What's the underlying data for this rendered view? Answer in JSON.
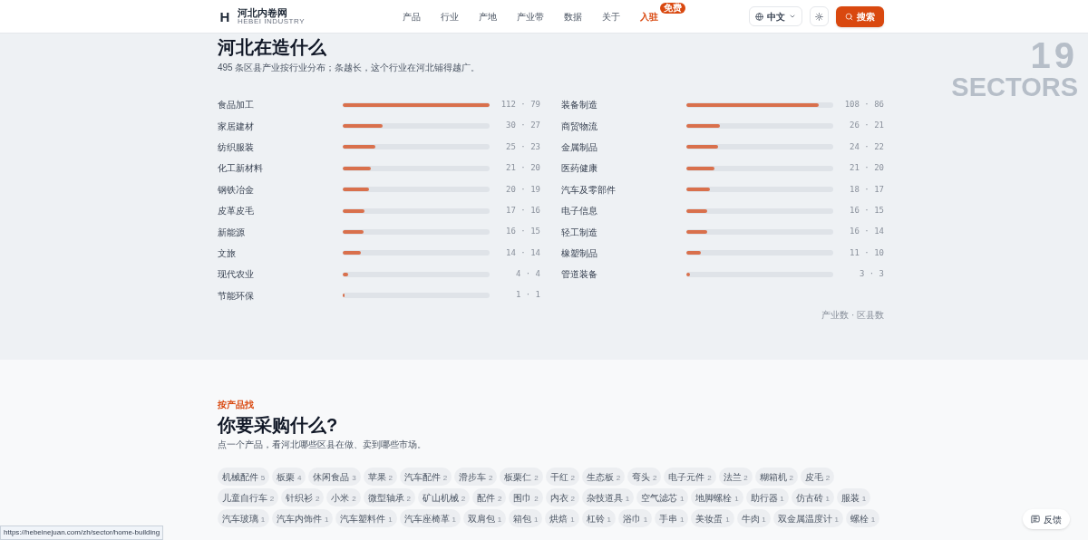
{
  "header": {
    "logo_letter": "H",
    "site_name": "河北内卷网",
    "site_subtitle": "HEBEI INDUSTRY",
    "nav": [
      {
        "label": "产品",
        "selected": false
      },
      {
        "label": "行业",
        "selected": false
      },
      {
        "label": "产地",
        "selected": false
      },
      {
        "label": "产业带",
        "selected": false
      },
      {
        "label": "数据",
        "selected": false
      },
      {
        "label": "关于",
        "selected": false
      },
      {
        "label": "入驻",
        "selected": true,
        "badge": "免费"
      }
    ],
    "language": "中文",
    "search_button": "搜索"
  },
  "sectors_section": {
    "title": "河北在造什么",
    "subtitle": "495 条区县产业按行业分布；条越长，这个行业在河北铺得越广。",
    "watermark_number": "19",
    "watermark_label": "SECTORS",
    "columns": [
      {
        "items": [
          {
            "name": "食品加工",
            "level": 1,
            "reading": "112 · 79"
          },
          {
            "name": "家居建材",
            "level": 0.27,
            "reading": "30 · 27"
          },
          {
            "name": "纺织服装",
            "level": 0.22,
            "reading": "25 · 23"
          },
          {
            "name": "化工新材料",
            "level": 0.19,
            "reading": "21 · 20"
          },
          {
            "name": "钢铁冶金",
            "level": 0.18,
            "reading": "20 · 19"
          },
          {
            "name": "皮革皮毛",
            "level": 0.15,
            "reading": "17 · 16"
          },
          {
            "name": "新能源",
            "level": 0.14,
            "reading": "16 · 15"
          },
          {
            "name": "文旅",
            "level": 0.125,
            "reading": "14 · 14"
          },
          {
            "name": "现代农业",
            "level": 0.036,
            "reading": "4 · 4"
          },
          {
            "name": "节能环保",
            "level": 0.01,
            "reading": "1 · 1"
          }
        ]
      },
      {
        "items": [
          {
            "name": "装备制造",
            "level": 0.9,
            "reading": "108 · 86"
          },
          {
            "name": "商贸物流",
            "level": 0.23,
            "reading": "26 · 21"
          },
          {
            "name": "金属制品",
            "level": 0.214,
            "reading": "24 · 22"
          },
          {
            "name": "医药健康",
            "level": 0.19,
            "reading": "21 · 20"
          },
          {
            "name": "汽车及零部件",
            "level": 0.16,
            "reading": "18 · 17"
          },
          {
            "name": "电子信息",
            "level": 0.143,
            "reading": "16 · 15"
          },
          {
            "name": "轻工制造",
            "level": 0.143,
            "reading": "16 · 14"
          },
          {
            "name": "橡塑制品",
            "level": 0.1,
            "reading": "11 · 10"
          },
          {
            "name": "管道装备",
            "level": 0.027,
            "reading": "3 · 3"
          }
        ]
      }
    ],
    "legend": "产业数 · 区县数"
  },
  "products_section": {
    "eyebrow": "按产品找",
    "title": "你要采购什么?",
    "subtitle": "点一个产品，看河北哪些区县在做、卖到哪些市场。",
    "chips": [
      {
        "name": "机械配件",
        "count": "5"
      },
      {
        "name": "板栗",
        "count": "4"
      },
      {
        "name": "休闲食品",
        "count": "3"
      },
      {
        "name": "苹果",
        "count": "2"
      },
      {
        "name": "汽车配件",
        "count": "2"
      },
      {
        "name": "滑步车",
        "count": "2"
      },
      {
        "name": "板栗仁",
        "count": "2"
      },
      {
        "name": "干红",
        "count": "2"
      },
      {
        "name": "生态板",
        "count": "2"
      },
      {
        "name": "弯头",
        "count": "2"
      },
      {
        "name": "电子元件",
        "count": "2"
      },
      {
        "name": "法兰",
        "count": "2"
      },
      {
        "name": "糊箱机",
        "count": "2"
      },
      {
        "name": "皮毛",
        "count": "2"
      },
      {
        "name": "儿童自行车",
        "count": "2"
      },
      {
        "name": "针织衫",
        "count": "2"
      },
      {
        "name": "小米",
        "count": "2"
      },
      {
        "name": "微型轴承",
        "count": "2"
      },
      {
        "name": "矿山机械",
        "count": "2"
      },
      {
        "name": "配件",
        "count": "2"
      },
      {
        "name": "围巾",
        "count": "2"
      },
      {
        "name": "内衣",
        "count": "2"
      },
      {
        "name": "杂技道具",
        "count": "1"
      },
      {
        "name": "空气滤芯",
        "count": "1"
      },
      {
        "name": "地脚螺栓",
        "count": "1"
      },
      {
        "name": "助行器",
        "count": "1"
      },
      {
        "name": "仿古砖",
        "count": "1"
      },
      {
        "name": "服装",
        "count": "1"
      },
      {
        "name": "汽车玻璃",
        "count": "1"
      },
      {
        "name": "汽车内饰件",
        "count": "1"
      },
      {
        "name": "汽车塑料件",
        "count": "1"
      },
      {
        "name": "汽车座椅革",
        "count": "1"
      },
      {
        "name": "双肩包",
        "count": "1"
      },
      {
        "name": "箱包",
        "count": "1"
      },
      {
        "name": "烘焙",
        "count": "1"
      },
      {
        "name": "杠铃",
        "count": "1"
      },
      {
        "name": "浴巾",
        "count": "1"
      },
      {
        "name": "手串",
        "count": "1"
      },
      {
        "name": "美妆蛋",
        "count": "1"
      },
      {
        "name": "牛肉",
        "count": "1"
      },
      {
        "name": "双金属温度计",
        "count": "1"
      },
      {
        "name": "螺栓",
        "count": "1"
      }
    ]
  },
  "feedback_button": "反馈",
  "status_url": "https://hebeinejuan.com/zh/sector/home-building"
}
